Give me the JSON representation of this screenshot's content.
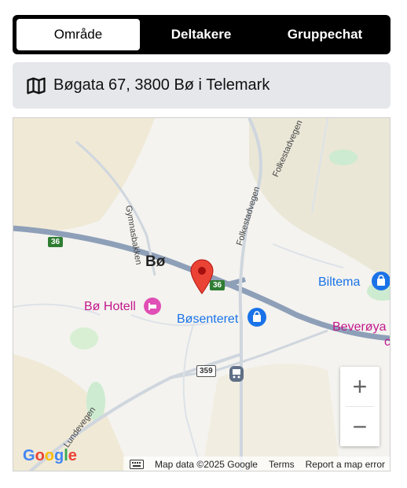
{
  "tabs": [
    {
      "label": "Område",
      "active": true
    },
    {
      "label": "Deltakere",
      "active": false
    },
    {
      "label": "Gruppechat",
      "active": false
    }
  ],
  "address": {
    "icon": "map-icon",
    "text": "Bøgata 67, 3800 Bø i Telemark"
  },
  "map": {
    "place_labels": {
      "town": "Bø",
      "hotel": "Bø Hotell",
      "shopping_center": "Bøsenteret",
      "store": "Biltema",
      "other": "Beverøya",
      "other_cut": "c"
    },
    "road_labels": {
      "gymnas": "Gymnasbakken",
      "folke_south": "Folkestadvegen",
      "folke_north": "Folkestadvegen",
      "lunde": "Lundevegen"
    },
    "route_shields": [
      "36",
      "36",
      "359"
    ],
    "zoom": {
      "in": "+",
      "out": "−"
    },
    "branding": "Google",
    "footer": {
      "data": "Map data ©2025 Google",
      "terms": "Terms",
      "report": "Report a map error"
    }
  },
  "colors": {
    "tab_bar": "#000000",
    "address_bg": "#e5e7eb",
    "marker": "#ea4335",
    "hotel": "#c2188c",
    "poi_blue": "#1a73e8",
    "highway": "#8e9fb8"
  }
}
